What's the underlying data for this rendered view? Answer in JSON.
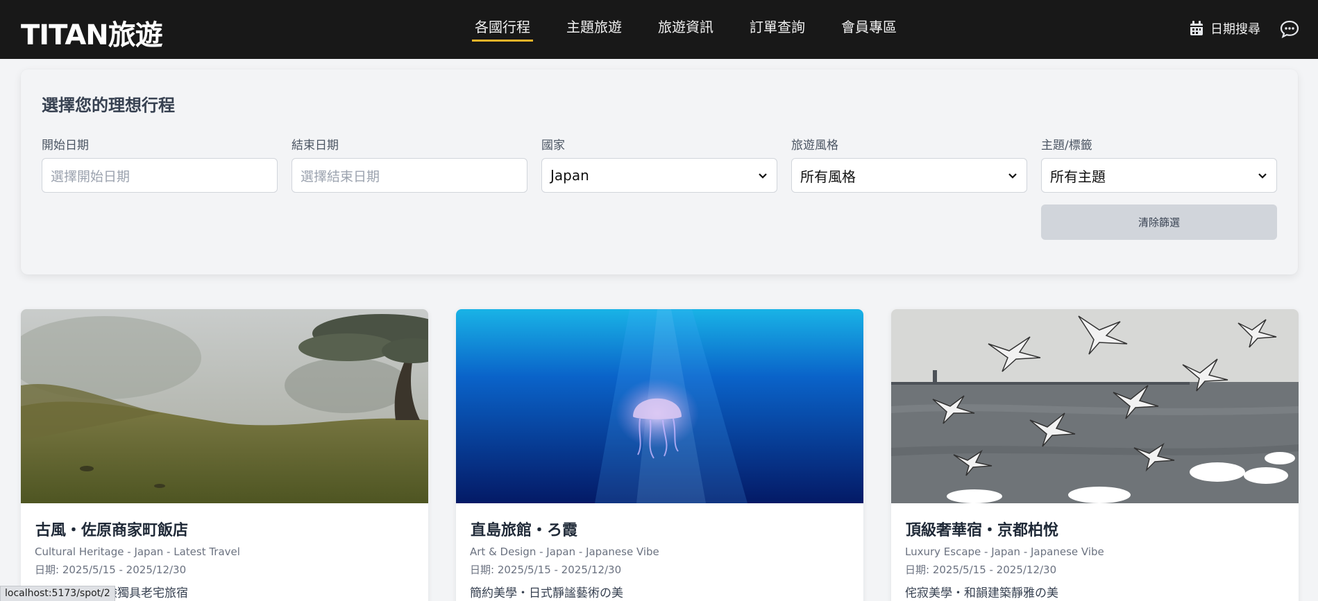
{
  "header": {
    "logo": "TITAN旅遊",
    "nav": [
      "各國行程",
      "主題旅遊",
      "旅遊資訊",
      "訂單查詢",
      "會員專區"
    ],
    "active_nav": "各國行程",
    "date_search_label": "日期搜尋",
    "date_search_icon": "calendar-icon",
    "chat_icon": "chat-icon"
  },
  "filters": {
    "title": "選擇您的理想行程",
    "start_date": {
      "label": "開始日期",
      "placeholder": "選擇開始日期"
    },
    "end_date": {
      "label": "結束日期",
      "placeholder": "選擇結束日期"
    },
    "country": {
      "label": "國家",
      "value": "Japan"
    },
    "style": {
      "label": "旅遊風格",
      "value": "所有風格"
    },
    "theme": {
      "label": "主題/標籤",
      "value": "所有主題"
    },
    "clear_label": "清除篩選"
  },
  "cards": [
    {
      "title": "古風・佐原商家町飯店",
      "tags": "Cultural Heritage - Japan - Latest Travel",
      "dates": "日期: 2025/5/15 - 2025/12/30",
      "desc": "懷舊創新・體驗獨具老宅旅宿",
      "image": "foggy-hillside-tree"
    },
    {
      "title": "直島旅館・ろ霞",
      "tags": "Art & Design - Japan - Japanese Vibe",
      "dates": "日期: 2025/5/15 - 2025/12/30",
      "desc": "簡約美學・日式靜謐藝術の美",
      "image": "jellyfish-underwater"
    },
    {
      "title": "頂級奢華宿・京都柏悅",
      "tags": "Luxury Escape - Japan - Japanese Vibe",
      "dates": "日期: 2025/5/15 - 2025/12/30",
      "desc": "侘寂美學・和韻建築靜雅の美",
      "image": "seagulls-over-sea"
    }
  ],
  "status_url": "localhost:5173/spot/2",
  "colors": {
    "header_bg": "#181818",
    "nav_active_underline": "#f0b429",
    "clear_button_bg": "#d1d5db"
  }
}
